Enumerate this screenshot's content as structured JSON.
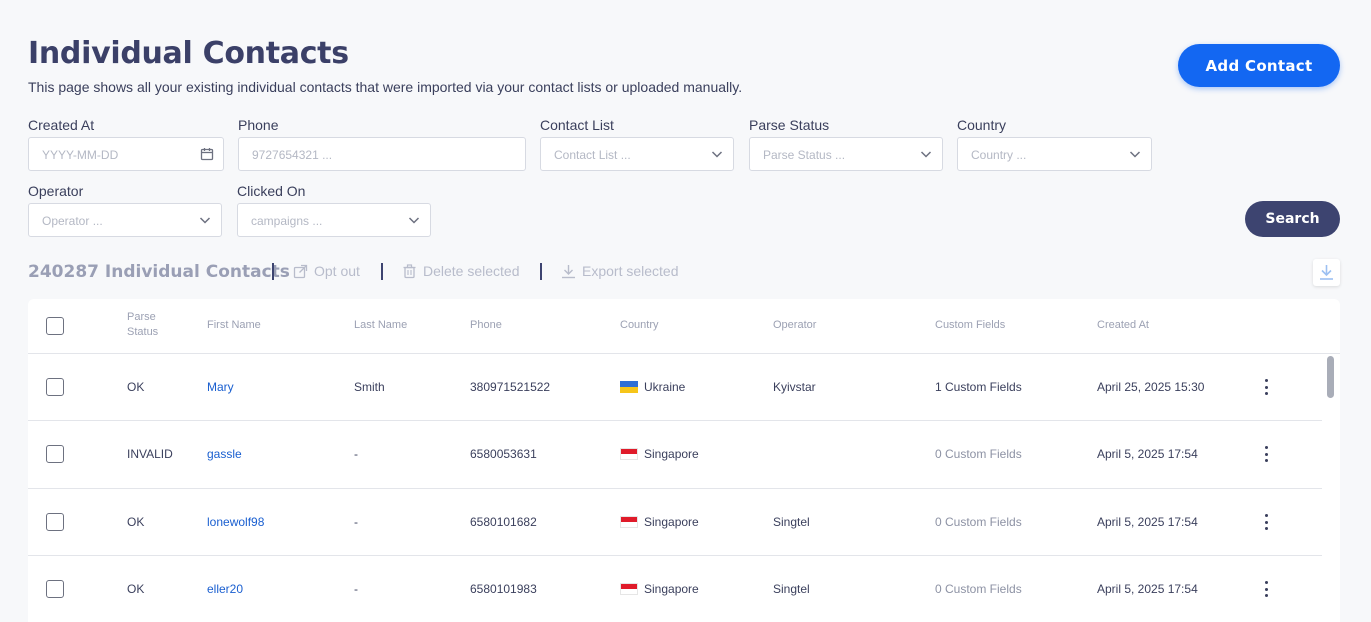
{
  "header": {
    "title": "Individual Contacts",
    "subtitle": "This page shows all your existing individual contacts that were imported via your contact lists or uploaded manually.",
    "add_button": "Add Contact"
  },
  "filters": {
    "created_at": {
      "label": "Created At",
      "placeholder": "YYYY-MM-DD"
    },
    "phone": {
      "label": "Phone",
      "placeholder": "9727654321 ..."
    },
    "contact_list": {
      "label": "Contact List",
      "placeholder": "Contact List ..."
    },
    "parse_status": {
      "label": "Parse Status",
      "placeholder": "Parse Status ..."
    },
    "country": {
      "label": "Country",
      "placeholder": "Country ..."
    },
    "operator": {
      "label": "Operator",
      "placeholder": "Operator ..."
    },
    "clicked_on": {
      "label": "Clicked On",
      "placeholder": "campaigns ..."
    },
    "search_button": "Search"
  },
  "toolbar": {
    "count_label": "240287 Individual Contacts",
    "opt_out": "Opt out",
    "delete_selected": "Delete selected",
    "export_selected": "Export selected"
  },
  "table": {
    "headers": {
      "parse_status": "Parse Status",
      "first_name": "First Name",
      "last_name": "Last Name",
      "phone": "Phone",
      "country": "Country",
      "operator": "Operator",
      "custom_fields": "Custom Fields",
      "created_at": "Created At"
    },
    "rows": [
      {
        "status": "OK",
        "first": "Mary",
        "last": "Smith",
        "phone": "380971521522",
        "country": "Ukraine",
        "operator": "Kyivstar",
        "custom": "1 Custom Fields",
        "created": "April 25, 2025 15:30"
      },
      {
        "status": "INVALID",
        "first": "gassle",
        "last": "-",
        "phone": "6580053631",
        "country": "Singapore",
        "operator": "",
        "custom": "0 Custom Fields",
        "created": "April 5, 2025 17:54"
      },
      {
        "status": "OK",
        "first": "lonewolf98",
        "last": "-",
        "phone": "6580101682",
        "country": "Singapore",
        "operator": "Singtel",
        "custom": "0 Custom Fields",
        "created": "April 5, 2025 17:54"
      },
      {
        "status": "OK",
        "first": "eller20",
        "last": "-",
        "phone": "6580101983",
        "country": "Singapore",
        "operator": "Singtel",
        "custom": "0 Custom Fields",
        "created": "April 5, 2025 17:54"
      }
    ]
  },
  "icons": {
    "calendar": "calendar-icon",
    "chevron": "chevron-down-icon",
    "opt_out": "external-link-icon",
    "trash": "trash-icon",
    "download": "download-icon",
    "kebab": "more-vertical-icon"
  },
  "colors": {
    "primary": "#1367f2",
    "dark_button": "#3d4470",
    "link": "#1a5fd0"
  }
}
